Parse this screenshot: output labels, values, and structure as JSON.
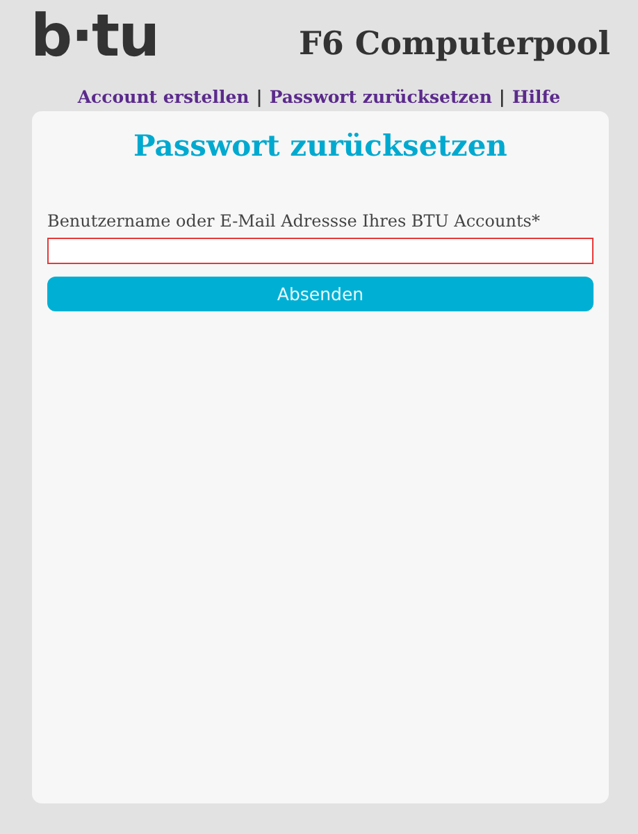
{
  "header": {
    "logo": "b·tu",
    "title": "F6 Computerpool"
  },
  "nav": [
    {
      "kind": "link",
      "label": "Account erstellen"
    },
    {
      "kind": "separator",
      "label": "|"
    },
    {
      "kind": "link",
      "label": "Passwort zurücksetzen"
    },
    {
      "kind": "separator",
      "label": "|"
    },
    {
      "kind": "link",
      "label": "Hilfe"
    }
  ],
  "card": {
    "heading": "Passwort zurücksetzen",
    "field": {
      "label": "Benutzername oder E-Mail Adressse Ihres BTU Accounts*",
      "invalid": true
    },
    "button": "Absenden"
  }
}
